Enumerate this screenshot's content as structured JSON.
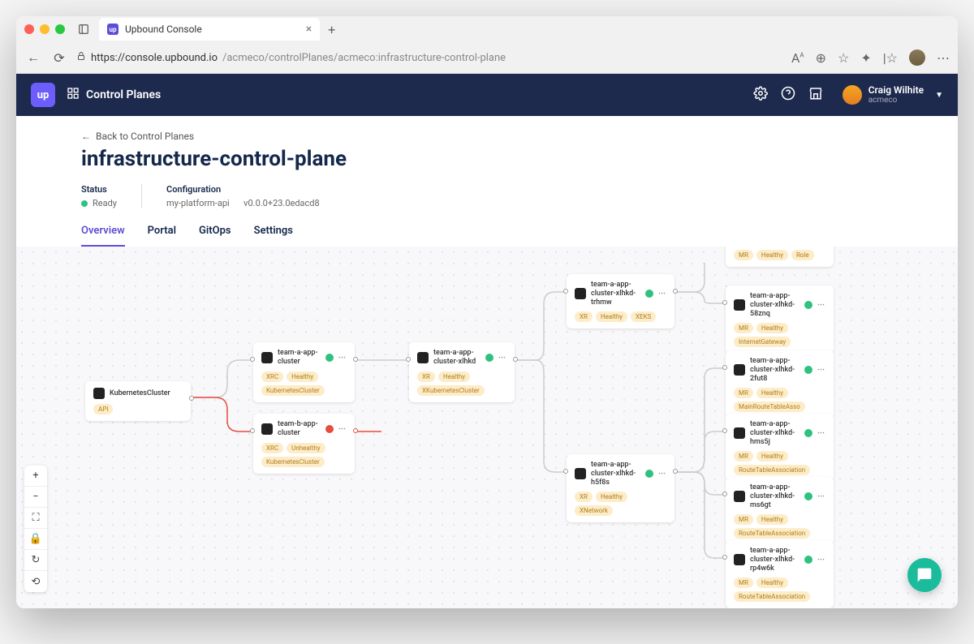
{
  "browser": {
    "tab_title": "Upbound Console",
    "url_prefix": "https://console.upbound.io",
    "url_path": "/acmeco/controlPlanes/acmeco:infrastructure-control-plane"
  },
  "header": {
    "nav_label": "Control Planes",
    "user_name": "Craig Wilhite",
    "user_org": "acmeco"
  },
  "page": {
    "back_label": "Back to Control Planes",
    "title": "infrastructure-control-plane",
    "status_label": "Status",
    "status_value": "Ready",
    "config_label": "Configuration",
    "config_name": "my-platform-api",
    "config_version": "v0.0.0+23.0edacd8",
    "tabs": [
      "Overview",
      "Portal",
      "GitOps",
      "Settings"
    ],
    "active_tab": 0
  },
  "nodes": {
    "root": {
      "name": "KubernetesCluster",
      "tags": [
        "API"
      ]
    },
    "teamA": {
      "name": "team-a-app-cluster",
      "tags": [
        "XRC",
        "Healthy",
        "KubernetesCluster"
      ],
      "status": "ok"
    },
    "teamB": {
      "name": "team-b-app-cluster",
      "tags": [
        "XRC",
        "Unhealthy",
        "KubernetesCluster"
      ],
      "status": "bad"
    },
    "teamAxlhkd": {
      "name": "team-a-app-cluster-xlhkd",
      "tags": [
        "XR",
        "Healthy",
        "XKubernetesCluster"
      ],
      "status": "ok"
    },
    "trhmw": {
      "name": "team-a-app-cluster-xlhkd-trhmw",
      "tags": [
        "XR",
        "Healthy",
        "XEKS"
      ],
      "status": "ok"
    },
    "h5f8s": {
      "name": "team-a-app-cluster-xlhkd-h5f8s",
      "tags": [
        "XR",
        "Healthy",
        "XNetwork"
      ],
      "status": "ok"
    },
    "r1": {
      "name": "",
      "tags": [
        "MR",
        "Healthy",
        "Role"
      ],
      "status": "ok"
    },
    "r2": {
      "name": "team-a-app-cluster-xlhkd-58znq",
      "tags": [
        "MR",
        "Healthy",
        "InternetGateway"
      ],
      "status": "ok"
    },
    "r3": {
      "name": "team-a-app-cluster-xlhkd-2fut8",
      "tags": [
        "MR",
        "Healthy",
        "MainRouteTableAsso"
      ],
      "status": "ok"
    },
    "r4": {
      "name": "team-a-app-cluster-xlhkd-hms5j",
      "tags": [
        "MR",
        "Healthy",
        "RouteTableAssociation"
      ],
      "status": "ok"
    },
    "r5": {
      "name": "team-a-app-cluster-xlhkd-ms6gt",
      "tags": [
        "MR",
        "Healthy",
        "RouteTableAssociation"
      ],
      "status": "ok"
    },
    "r6": {
      "name": "team-a-app-cluster-xlhkd-rp4w6k",
      "tags": [
        "MR",
        "Healthy",
        "RouteTableAssociation"
      ],
      "status": "ok"
    }
  }
}
